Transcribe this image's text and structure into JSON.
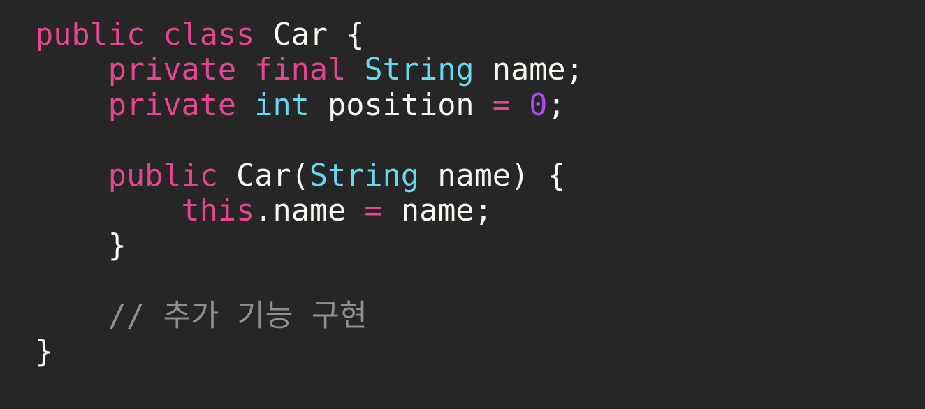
{
  "colors": {
    "background": "#262626",
    "keyword": "#e5468f",
    "type": "#66d9ef",
    "number": "#ae4bf0",
    "text": "#f8f8f2",
    "comment": "#8f8f8f"
  },
  "code": {
    "lines": [
      [
        {
          "t": "public",
          "c": "kw"
        },
        {
          "t": " ",
          "c": "plain"
        },
        {
          "t": "class",
          "c": "kw"
        },
        {
          "t": " Car {",
          "c": "plain"
        }
      ],
      [
        {
          "t": "    ",
          "c": "plain"
        },
        {
          "t": "private",
          "c": "kw"
        },
        {
          "t": " ",
          "c": "plain"
        },
        {
          "t": "final",
          "c": "kw"
        },
        {
          "t": " ",
          "c": "plain"
        },
        {
          "t": "String",
          "c": "ty"
        },
        {
          "t": " name;",
          "c": "plain"
        }
      ],
      [
        {
          "t": "    ",
          "c": "plain"
        },
        {
          "t": "private",
          "c": "kw"
        },
        {
          "t": " ",
          "c": "plain"
        },
        {
          "t": "int",
          "c": "ty"
        },
        {
          "t": " position ",
          "c": "plain"
        },
        {
          "t": "=",
          "c": "op"
        },
        {
          "t": " ",
          "c": "plain"
        },
        {
          "t": "0",
          "c": "num"
        },
        {
          "t": ";",
          "c": "plain"
        }
      ],
      [],
      [
        {
          "t": "    ",
          "c": "plain"
        },
        {
          "t": "public",
          "c": "kw"
        },
        {
          "t": " Car(",
          "c": "plain"
        },
        {
          "t": "String",
          "c": "ty"
        },
        {
          "t": " name) {",
          "c": "plain"
        }
      ],
      [
        {
          "t": "        ",
          "c": "plain"
        },
        {
          "t": "this",
          "c": "kw"
        },
        {
          "t": ".name ",
          "c": "plain"
        },
        {
          "t": "=",
          "c": "op"
        },
        {
          "t": " name;",
          "c": "plain"
        }
      ],
      [
        {
          "t": "    }",
          "c": "plain"
        }
      ],
      [],
      [
        {
          "t": "    ",
          "c": "plain"
        },
        {
          "t": "// 추가 기능 구현",
          "c": "cm"
        }
      ],
      [
        {
          "t": "}",
          "c": "plain"
        }
      ]
    ]
  }
}
